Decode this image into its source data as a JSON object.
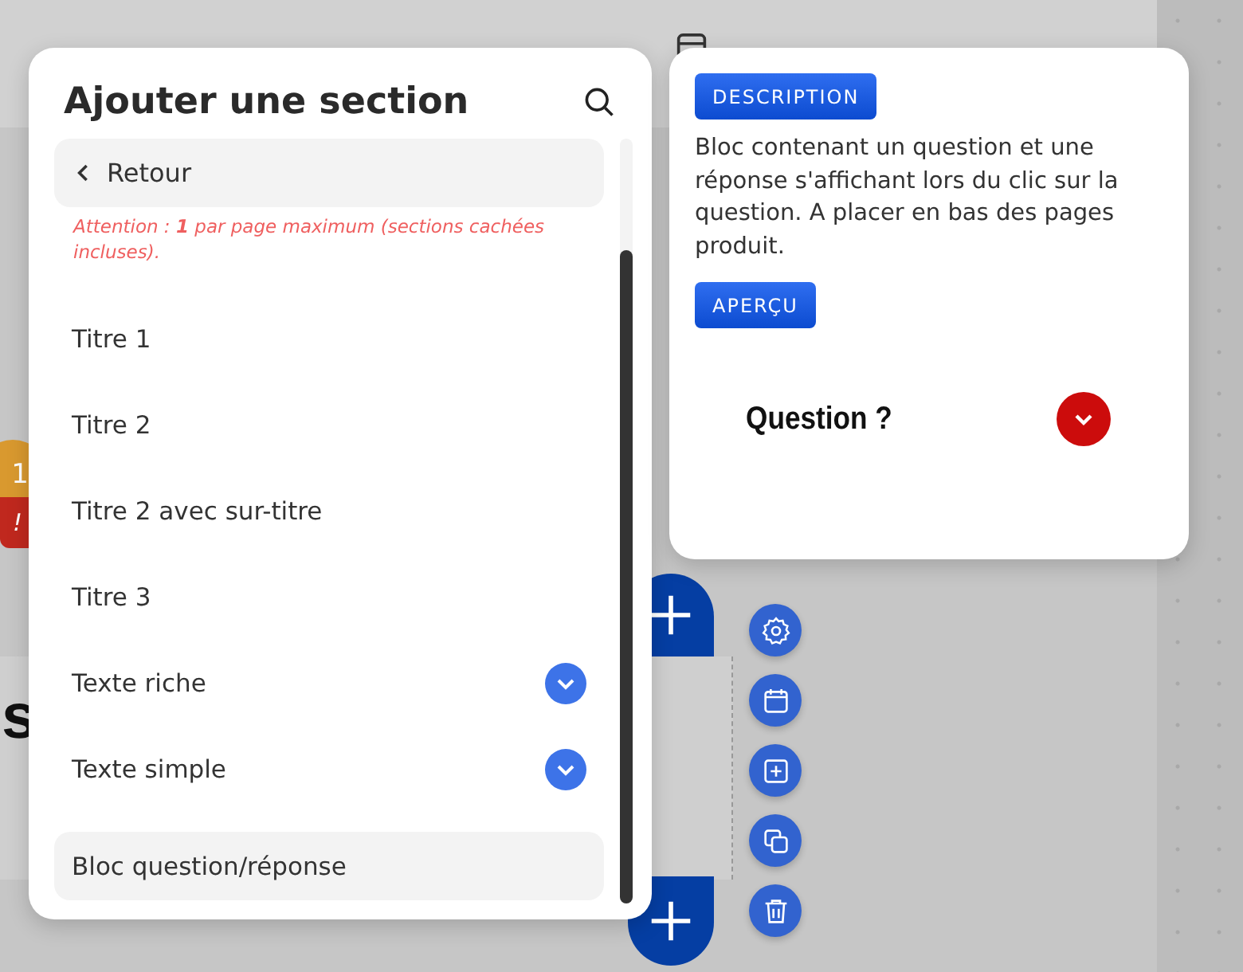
{
  "background": {
    "badge": "1",
    "alert": "!",
    "heading_fragment": "s"
  },
  "section_panel": {
    "title": "Ajouter une section",
    "back_button": "Retour",
    "warning": "Attention : **1** par page maximum (sections cachées incluses).",
    "items": [
      {
        "label": "Titre 1",
        "expandable": false,
        "selected": false
      },
      {
        "label": "Titre 2",
        "expandable": false,
        "selected": false
      },
      {
        "label": "Titre 2 avec sur-titre",
        "expandable": false,
        "selected": false
      },
      {
        "label": "Titre 3",
        "expandable": false,
        "selected": false
      },
      {
        "label": "Texte riche",
        "expandable": true,
        "selected": false
      },
      {
        "label": "Texte simple",
        "expandable": true,
        "selected": false
      },
      {
        "label": "Bloc question/réponse",
        "expandable": false,
        "selected": true
      }
    ]
  },
  "preview_panel": {
    "description_button": "DESCRIPTION",
    "description": "Bloc contenant un question et une réponse s'affichant lors du clic sur la question. A placer en bas des pages produit.",
    "preview_button": "APERÇU",
    "question": "Question ?"
  }
}
